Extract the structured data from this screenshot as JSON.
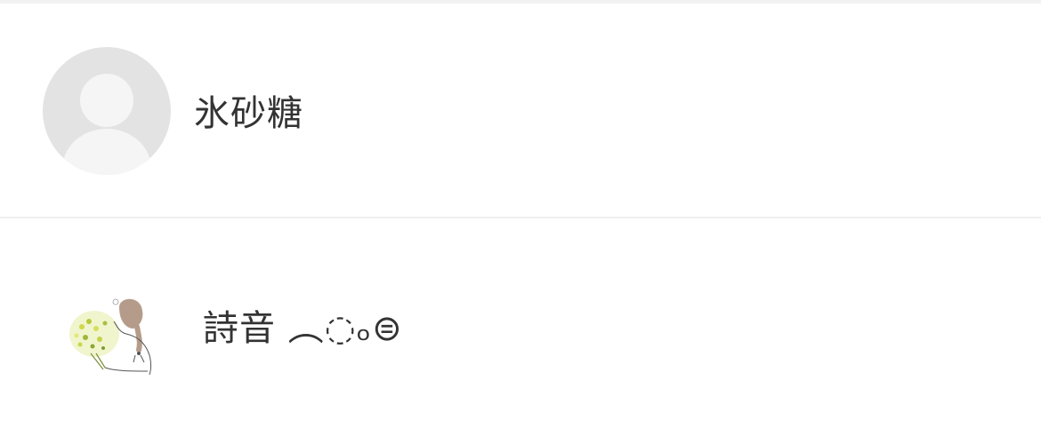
{
  "list": {
    "items": [
      {
        "name": "氷砂糖",
        "avatar": "default-user-avatar-icon"
      },
      {
        "name": "詩音 ︵◌ₒ⊜",
        "avatar": "illustrated-girl-with-flowers-avatar"
      }
    ]
  },
  "colors": {
    "text": "#333333",
    "divider": "#efefef",
    "avatar_bg": "#e3e3e3",
    "avatar_fg": "#f5f5f5"
  }
}
